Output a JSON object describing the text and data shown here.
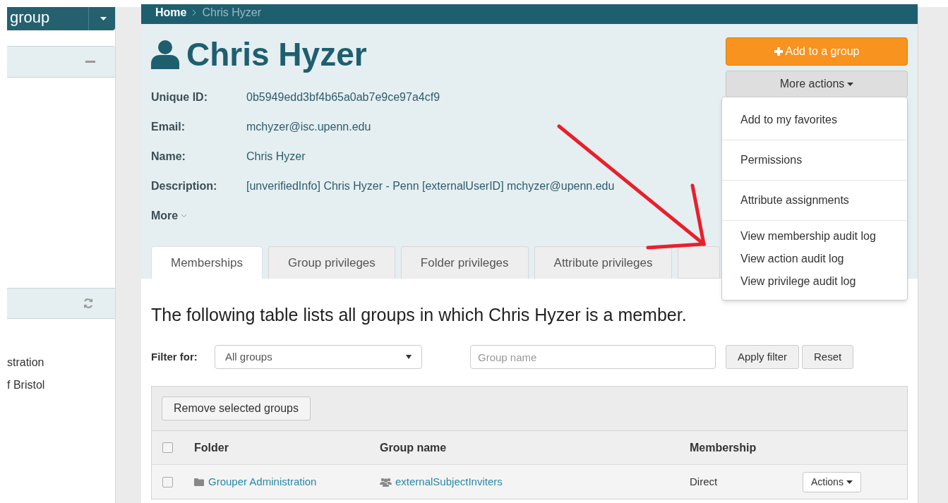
{
  "sidebar": {
    "group_button": "group",
    "items": [
      "stration",
      "f Bristol"
    ]
  },
  "breadcrumb": [
    "Home",
    "Chris Hyzer"
  ],
  "title": "Chris Hyzer",
  "fields": [
    {
      "label": "Unique ID:",
      "value": "0b5949edd3bf4b65a0ab7e9ce97a4cf9"
    },
    {
      "label": "Email:",
      "value": "mchyzer@isc.upenn.edu"
    },
    {
      "label": "Name:",
      "value": "Chris Hyzer"
    },
    {
      "label": "Description:",
      "value": "[unverifiedInfo] Chris Hyzer - Penn [externalUserID] mchyzer@upenn.edu"
    }
  ],
  "more_link": "More",
  "add_button": "Add to a group",
  "more_actions": {
    "label": "More actions",
    "expanded": true,
    "menu": [
      [
        "Add to my favorites"
      ],
      [
        "Permissions"
      ],
      [
        "Attribute assignments"
      ],
      [
        "View membership audit log",
        "View action audit log",
        "View privilege audit log"
      ]
    ]
  },
  "tabs": [
    {
      "label": "Memberships",
      "selected": true
    },
    {
      "label": "Group privileges",
      "selected": false
    },
    {
      "label": "Folder privileges",
      "selected": false
    },
    {
      "label": "Attribute privileges",
      "selected": false
    }
  ],
  "intro": "The following table lists all groups in which Chris Hyzer is a member.",
  "filter": {
    "label": "Filter for:",
    "select": "All groups",
    "search_placeholder": "Group name",
    "apply": "Apply filter",
    "reset": "Reset"
  },
  "table": {
    "remove_button": "Remove selected groups",
    "all_checked": false,
    "columns": [
      "Folder",
      "Group name",
      "Membership"
    ],
    "rows": [
      {
        "checked": false,
        "folder": "Grouper Administration",
        "group": "externalSubjectInviters",
        "membership": "Direct",
        "action": "Actions"
      }
    ]
  }
}
